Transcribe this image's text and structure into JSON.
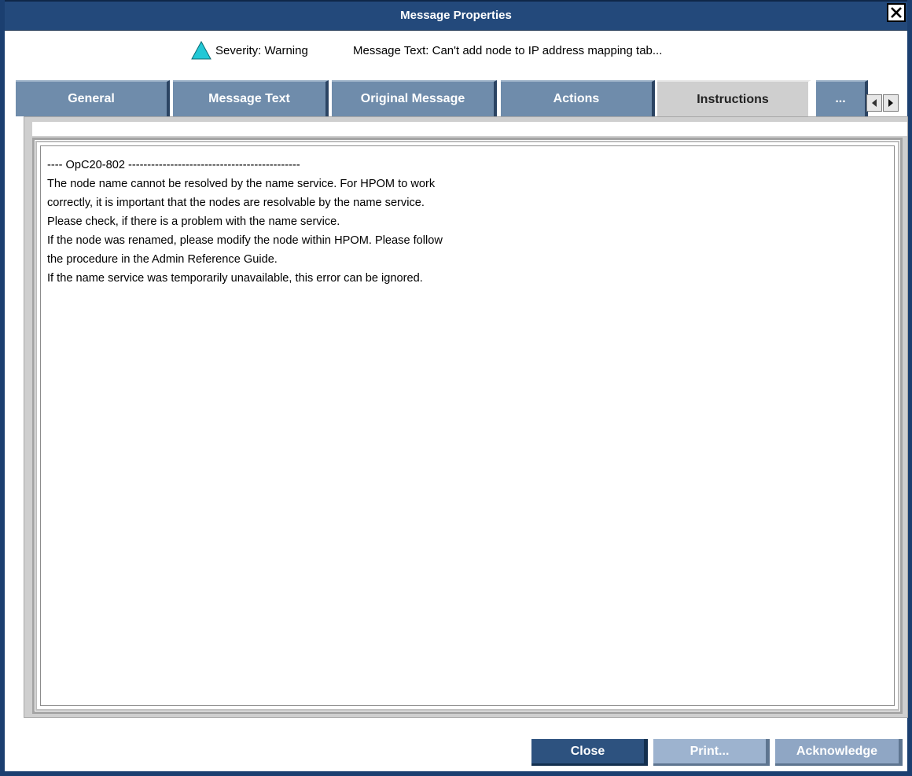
{
  "window": {
    "title": "Message Properties",
    "close_icon": "close-icon"
  },
  "header": {
    "severity_icon": "warning-triangle-icon",
    "severity_label": "Severity: Warning",
    "message_text_label": "Message Text: Can't add node to IP address mapping tab..."
  },
  "tabs": [
    {
      "label": "General",
      "active": false
    },
    {
      "label": "Message Text",
      "active": false
    },
    {
      "label": "Original Message",
      "active": false
    },
    {
      "label": "Actions",
      "active": false
    },
    {
      "label": "Instructions",
      "active": true
    },
    {
      "label": "...",
      "active": false
    }
  ],
  "tab_scroll": {
    "left_icon": "scroll-left-icon",
    "right_icon": "scroll-right-icon"
  },
  "instructions": {
    "lines": [
      "---- OpC20-802 ---------------------------------------------",
      "The node name cannot be resolved by the name service. For HPOM to work",
      "correctly, it is important that the nodes are resolvable by the name service.",
      "Please check, if there is a problem with the name service.",
      "If the node was renamed, please modify the node within HPOM. Please follow",
      "the procedure in the Admin Reference Guide.",
      "If the name service was temporarily unavailable, this error can be ignored."
    ]
  },
  "buttons": {
    "close": "Close",
    "print": "Print...",
    "acknowledge": "Acknowledge"
  },
  "colors": {
    "titlebar": "#23497b",
    "tab_inactive": "#6f8cab",
    "tab_active": "#cfcfcf",
    "warning_icon": "#22c8d6",
    "primary_button": "#2d527f",
    "secondary_button": "#9db3cf"
  }
}
